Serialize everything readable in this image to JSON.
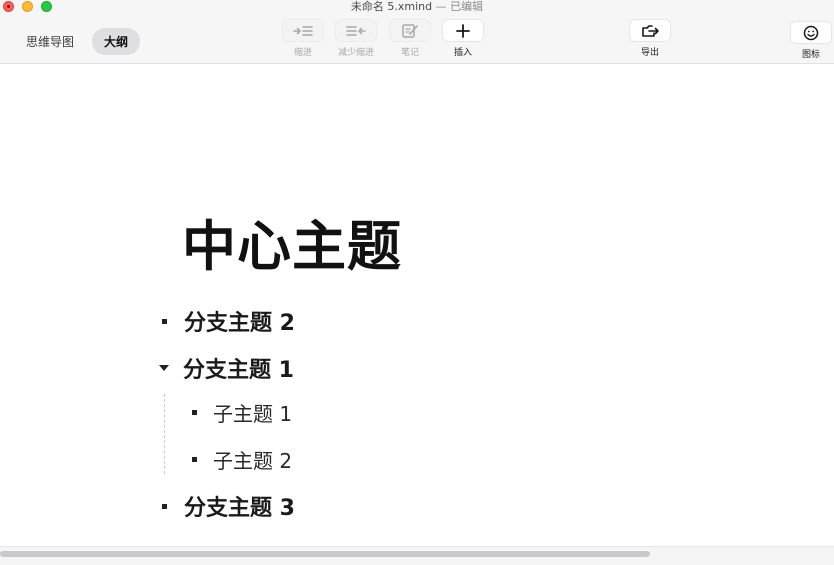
{
  "window": {
    "filename": "未命名 5.xmind",
    "status": " — 已编辑"
  },
  "views": {
    "mindmap_label": "思维导图",
    "outline_label": "大纲",
    "active": "outline"
  },
  "toolbar": {
    "indent_label": "缩进",
    "outdent_label": "减少缩进",
    "note_label": "笔记",
    "insert_label": "插入",
    "export_label": "导出",
    "icon_label": "图标"
  },
  "outline": {
    "central_topic": "中心主题",
    "branches": [
      {
        "label": "分支主题 2",
        "collapsed": true,
        "children": []
      },
      {
        "label": "分支主题 1",
        "expanded": true,
        "children": [
          {
            "label": "子主题 1"
          },
          {
            "label": "子主题 2"
          }
        ]
      },
      {
        "label": "分支主题 3",
        "collapsed": true,
        "children": []
      }
    ]
  },
  "colors": {
    "close": "#ff5f57",
    "minimize": "#febc2e",
    "maximize": "#28c840",
    "toolbar_bg": "#f6f6f7"
  }
}
